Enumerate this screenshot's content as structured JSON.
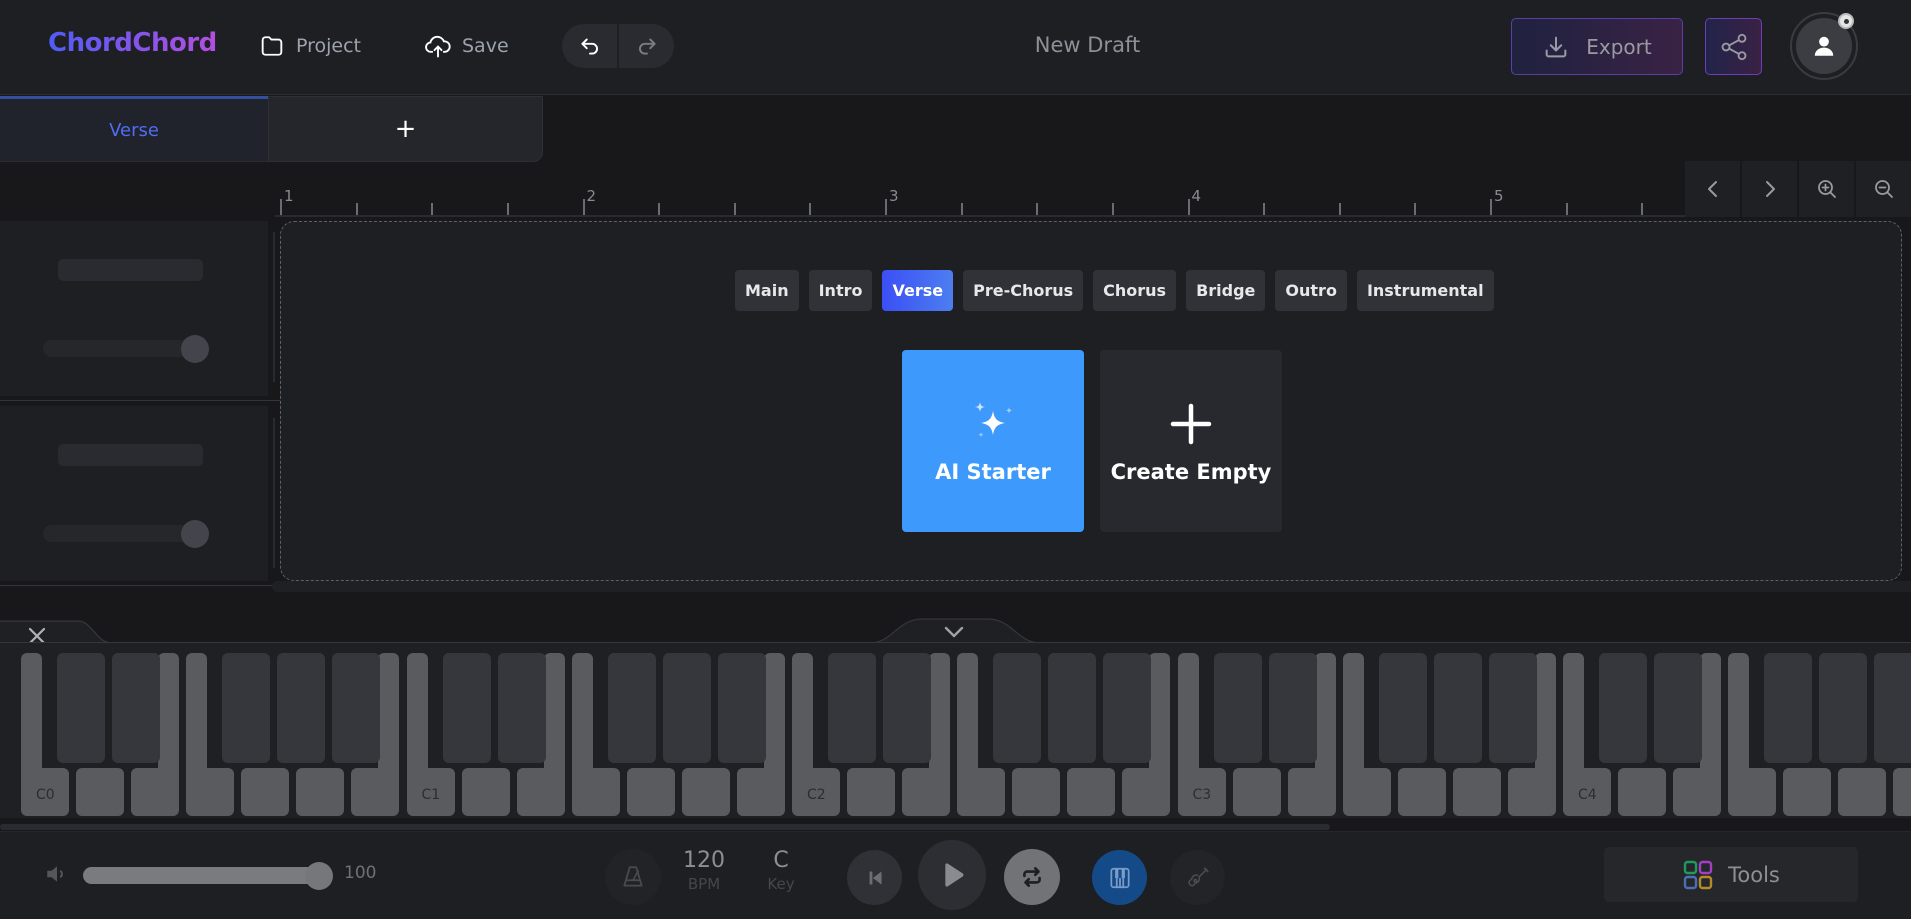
{
  "header": {
    "logo": "ChordChord",
    "project_label": "Project",
    "save_label": "Save",
    "doc_title": "New Draft",
    "export_label": "Export"
  },
  "section_tabs": [
    {
      "label": "Verse",
      "active": true
    },
    {
      "label": "+",
      "active": false
    }
  ],
  "ruler": {
    "bars": [
      "1",
      "2",
      "3",
      "4",
      "5"
    ],
    "subdivisions_per_bar": 4
  },
  "tracks": [
    {
      "volume": 1.0
    },
    {
      "volume": 1.0
    }
  ],
  "canvas": {
    "section_types": [
      {
        "label": "Main",
        "active": false
      },
      {
        "label": "Intro",
        "active": false
      },
      {
        "label": "Verse",
        "active": true
      },
      {
        "label": "Pre-Chorus",
        "active": false
      },
      {
        "label": "Chorus",
        "active": false
      },
      {
        "label": "Bridge",
        "active": false
      },
      {
        "label": "Outro",
        "active": false
      },
      {
        "label": "Instrumental",
        "active": false
      }
    ],
    "ai_starter_label": "AI Starter",
    "create_empty_label": "Create Empty"
  },
  "piano": {
    "octave_labels": [
      "C0",
      "C1",
      "C2",
      "C3",
      "C4"
    ]
  },
  "transport": {
    "volume": "100",
    "volume_fraction": 1.0,
    "bpm_value": "120",
    "bpm_label": "BPM",
    "key_value": "C",
    "key_label": "Key",
    "tools_label": "Tools"
  },
  "colors": {
    "accent_blue": "#3d99fb",
    "active_tab_blue": "#4f6df5",
    "piano_mode_active": "#154a88",
    "tools_icon": [
      "#1f9a5a",
      "#a23fc4",
      "#4a6fb5",
      "#b58a2a"
    ]
  }
}
